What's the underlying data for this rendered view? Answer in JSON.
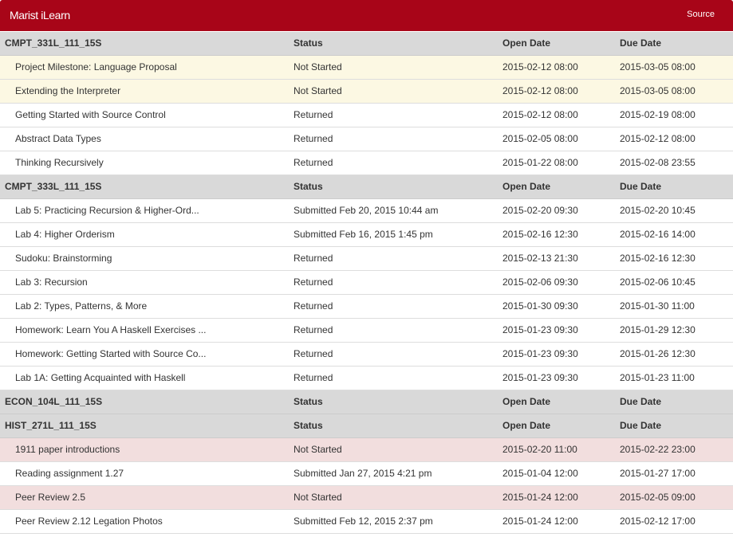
{
  "app": {
    "title": "Marist iLearn",
    "source_link": "Source"
  },
  "columns": {
    "status": "Status",
    "open_date": "Open Date",
    "due_date": "Due Date"
  },
  "courses": [
    {
      "code": "CMPT_331L_111_15S",
      "assignments": [
        {
          "title": "Project Milestone: Language Proposal",
          "status": "Not Started",
          "open": "2015-02-12 08:00",
          "due": "2015-03-05 08:00",
          "state": "not-started"
        },
        {
          "title": "Extending the Interpreter",
          "status": "Not Started",
          "open": "2015-02-12 08:00",
          "due": "2015-03-05 08:00",
          "state": "not-started"
        },
        {
          "title": "Getting Started with Source Control",
          "status": "Returned",
          "open": "2015-02-12 08:00",
          "due": "2015-02-19 08:00",
          "state": "normal"
        },
        {
          "title": "Abstract Data Types",
          "status": "Returned",
          "open": "2015-02-05 08:00",
          "due": "2015-02-12 08:00",
          "state": "normal"
        },
        {
          "title": "Thinking Recursively",
          "status": "Returned",
          "open": "2015-01-22 08:00",
          "due": "2015-02-08 23:55",
          "state": "normal"
        }
      ]
    },
    {
      "code": "CMPT_333L_111_15S",
      "assignments": [
        {
          "title": "Lab 5: Practicing Recursion & Higher-Ord...",
          "status": "Submitted Feb 20, 2015 10:44 am",
          "open": "2015-02-20 09:30",
          "due": "2015-02-20 10:45",
          "state": "normal"
        },
        {
          "title": "Lab 4: Higher Orderism",
          "status": "Submitted Feb 16, 2015 1:45 pm",
          "open": "2015-02-16 12:30",
          "due": "2015-02-16 14:00",
          "state": "normal"
        },
        {
          "title": "Sudoku: Brainstorming",
          "status": "Returned",
          "open": "2015-02-13 21:30",
          "due": "2015-02-16 12:30",
          "state": "normal"
        },
        {
          "title": "Lab 3: Recursion",
          "status": "Returned",
          "open": "2015-02-06 09:30",
          "due": "2015-02-06 10:45",
          "state": "normal"
        },
        {
          "title": "Lab 2: Types, Patterns, & More",
          "status": "Returned",
          "open": "2015-01-30 09:30",
          "due": "2015-01-30 11:00",
          "state": "normal"
        },
        {
          "title": "Homework: Learn You A Haskell Exercises ...",
          "status": "Returned",
          "open": "2015-01-23 09:30",
          "due": "2015-01-29 12:30",
          "state": "normal"
        },
        {
          "title": "Homework: Getting Started with Source Co...",
          "status": "Returned",
          "open": "2015-01-23 09:30",
          "due": "2015-01-26 12:30",
          "state": "normal"
        },
        {
          "title": "Lab 1A: Getting Acquainted with Haskell",
          "status": "Returned",
          "open": "2015-01-23 09:30",
          "due": "2015-01-23 11:00",
          "state": "normal"
        }
      ]
    },
    {
      "code": "ECON_104L_111_15S",
      "assignments": []
    },
    {
      "code": "HIST_271L_111_15S",
      "assignments": [
        {
          "title": "1911 paper introductions",
          "status": "Not Started",
          "open": "2015-02-20 11:00",
          "due": "2015-02-22 23:00",
          "state": "overdue"
        },
        {
          "title": "Reading assignment 1.27",
          "status": "Submitted Jan 27, 2015 4:21 pm",
          "open": "2015-01-04 12:00",
          "due": "2015-01-27 17:00",
          "state": "normal"
        },
        {
          "title": "Peer Review 2.5",
          "status": "Not Started",
          "open": "2015-01-24 12:00",
          "due": "2015-02-05 09:00",
          "state": "overdue"
        },
        {
          "title": "Peer Review 2.12 Legation Photos",
          "status": "Submitted Feb 12, 2015 2:37 pm",
          "open": "2015-01-24 12:00",
          "due": "2015-02-12 17:00",
          "state": "normal"
        }
      ]
    }
  ]
}
